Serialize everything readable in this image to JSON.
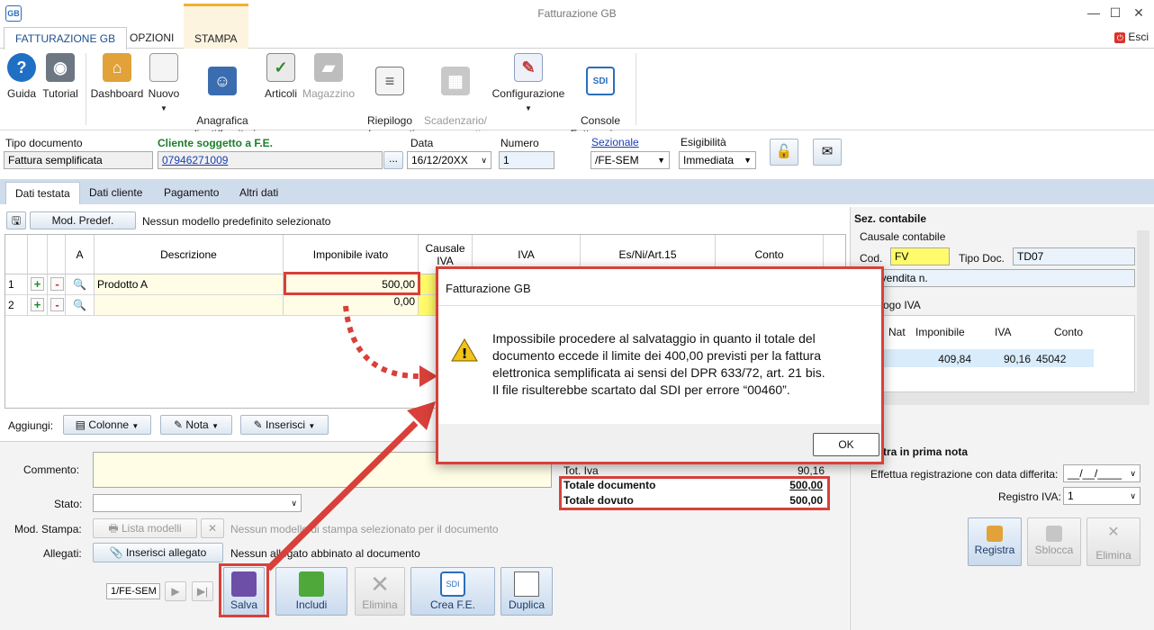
{
  "window": {
    "title": "Fatturazione GB",
    "logo": "GB",
    "exit_label": "Esci"
  },
  "menu_tabs": [
    "FATTURAZIONE GB",
    "OPZIONI",
    "STAMPA"
  ],
  "ribbon": [
    {
      "label": "Guida",
      "icon": "help-icon"
    },
    {
      "label": "Tutorial",
      "icon": "camera-icon"
    },
    {
      "label": "Dashboard",
      "icon": "home-icon"
    },
    {
      "label": "Nuovo",
      "icon": "new-document-icon"
    },
    {
      "label": "Anagrafica\nclienti/fornitori",
      "icon": "user-icon"
    },
    {
      "label": "Articoli",
      "icon": "checklist-icon"
    },
    {
      "label": "Magazzino",
      "icon": "truck-icon"
    },
    {
      "label": "Riepilogo\ndocumenti",
      "icon": "list-document-icon"
    },
    {
      "label": "Scadenzario/\npagamenti",
      "icon": "calculator-icon"
    },
    {
      "label": "Configurazione",
      "icon": "settings-pen-icon"
    },
    {
      "label": "Console\nFatturazione",
      "icon": "sdi-icon"
    }
  ],
  "document": {
    "tipo_label": "Tipo documento",
    "tipo_value": "Fattura semplificata",
    "cliente_label": "Cliente soggetto a F.E.",
    "cliente_value": "07946271009",
    "browse": "...",
    "data_label": "Data",
    "data_value": "16/12/20XX",
    "numero_label": "Numero",
    "numero_value": "1",
    "sezionale_label": "Sezionale",
    "sezionale_value": "/FE-SEM",
    "esigibilita_label": "Esigibilità",
    "esigibilita_value": "Immediata"
  },
  "sub_tabs": [
    "Dati testata",
    "Dati cliente",
    "Pagamento",
    "Altri dati"
  ],
  "model_bar": {
    "button": "Mod. Predef.",
    "text": "Nessun modello predefinito selezionato"
  },
  "grid": {
    "headers": [
      "A",
      "Descrizione",
      "Imponibile ivato",
      "Causale\nIVA",
      "IVA",
      "Es/Ni/Art.15",
      "Conto"
    ],
    "rows": [
      {
        "num": "1",
        "descrizione": "Prodotto A",
        "imponibile": "500,00"
      },
      {
        "num": "2",
        "descrizione": "",
        "imponibile": "0,00"
      }
    ],
    "plus": "+",
    "minus": "-"
  },
  "add_bar": {
    "label": "Aggiungi:",
    "colonne": "Colonne",
    "nota": "Nota",
    "inserisci": "Inserisci"
  },
  "bottom": {
    "commento_label": "Commento:",
    "stato_label": "Stato:",
    "mod_stampa_label": "Mod. Stampa:",
    "lista_modelli": "Lista modelli",
    "close_x": "✕",
    "mod_stampa_text": "Nessun modello di stampa selezionato per il documento",
    "allegati_label": "Allegati:",
    "inserisci_allegato": "Inserisci allegato",
    "allegati_text": "Nessun allegato abbinato al documento",
    "nav_value": "1/FE-SEM",
    "actions": [
      {
        "label": "Salva"
      },
      {
        "label": "Includi"
      },
      {
        "label": "Elimina"
      },
      {
        "label": "Crea F.E."
      },
      {
        "label": "Duplica"
      }
    ]
  },
  "totals": {
    "iva_label": "Tot. Iva",
    "iva_value": "90,16",
    "documento_label": "Totale documento",
    "documento_value": "500,00",
    "dovuto_label": "Totale dovuto",
    "dovuto_value": "500,00"
  },
  "right_panel": {
    "sez_title": "Sez. contabile",
    "causale_title": "Causale contabile",
    "cod_label": "Cod.",
    "cod_value": "FV",
    "tipo_doc_label": "Tipo Doc.",
    "tipo_doc_value": "TD07",
    "desc_value": "ra di vendita n.",
    "riepilogo_title": "ogo IVA",
    "iva_headers": [
      "Nat",
      "Imponibile",
      "IVA",
      "Conto"
    ],
    "iva_row": {
      "imponibile": "409,84",
      "iva": "90,16",
      "conto": "45042"
    },
    "prima_nota_title": "tra in prima nota",
    "differita_label": "Effettua registrazione con data differita:",
    "differita_value": "__/__/____",
    "registro_label": "Registro IVA:",
    "registro_value": "1",
    "buttons": [
      {
        "label": "Registra"
      },
      {
        "label": "Sblocca"
      },
      {
        "label": "Elimina"
      }
    ]
  },
  "dialog": {
    "title": "Fatturazione GB",
    "message_lines": [
      "Impossibile procedere al salvataggio in quanto il totale del",
      "documento eccede il limite dei 400,00 previsti per la fattura",
      "elettronica semplificata ai sensi del DPR 633/72, art. 21 bis.",
      "Il file risulterebbe scartato dal SDI per errore “00460”."
    ],
    "ok": "OK"
  },
  "colors": {
    "accent_red": "#d9403a",
    "ribbon_blue": "#1c4f8c",
    "green": "#1a7f2a",
    "yellow": "#fffb6a"
  }
}
